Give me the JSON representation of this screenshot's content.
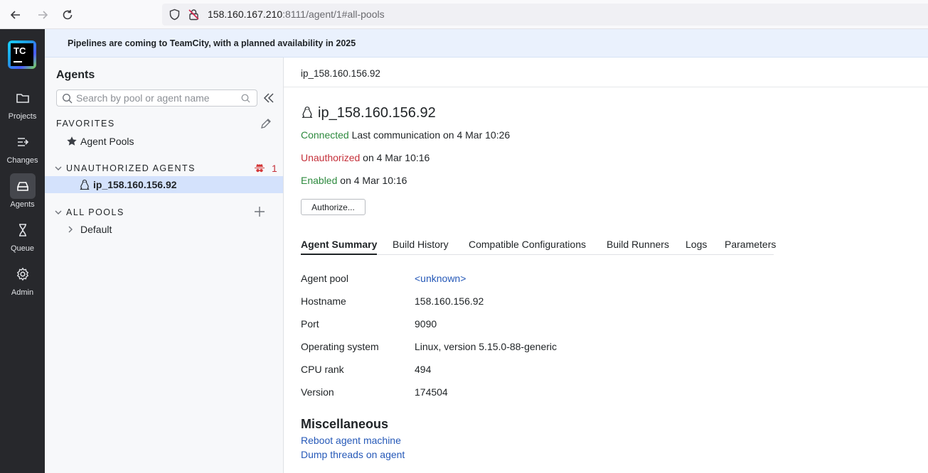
{
  "browser": {
    "url_host": "158.160.167.210",
    "url_rest": ":8111/agent/1#all-pools"
  },
  "rail": {
    "logo_text": "TC",
    "items": [
      {
        "label": "Projects",
        "icon": "folder-icon"
      },
      {
        "label": "Changes",
        "icon": "changes-icon"
      },
      {
        "label": "Agents",
        "icon": "agents-icon"
      },
      {
        "label": "Queue",
        "icon": "hourglass-icon"
      },
      {
        "label": "Admin",
        "icon": "gear-icon"
      }
    ],
    "active": "Agents"
  },
  "banner": {
    "text": "Pipelines are coming to TeamCity, with a planned availability in 2025"
  },
  "sidebar": {
    "title": "Agents",
    "search_placeholder": "Search by pool or agent name",
    "favorites_label": "FAVORITES",
    "agent_pools_label": "Agent Pools",
    "unauthorized_label": "UNAUTHORIZED AGENTS",
    "unauthorized_count": "1",
    "selected_agent": "ip_158.160.156.92",
    "all_pools_label": "ALL POOLS",
    "default_pool": "Default"
  },
  "main": {
    "breadcrumb": "ip_158.160.156.92",
    "agent_name": "ip_158.160.156.92",
    "connected_label": "Connected",
    "connected_detail": "Last communication on 4 Mar 10:26",
    "unauthorized_label": "Unauthorized",
    "unauthorized_detail": "on 4 Mar 10:16",
    "enabled_label": "Enabled",
    "enabled_detail": "on 4 Mar 10:16",
    "authorize_button": "Authorize...",
    "tabs": [
      "Agent Summary",
      "Build History",
      "Compatible Configurations",
      "Build Runners",
      "Logs",
      "Parameters"
    ],
    "active_tab": "Agent Summary",
    "properties": [
      {
        "label": "Agent pool",
        "value": "<unknown>"
      },
      {
        "label": "Hostname",
        "value": "158.160.156.92"
      },
      {
        "label": "Port",
        "value": "9090"
      },
      {
        "label": "Operating system",
        "value": "Linux, version 5.15.0-88-generic"
      },
      {
        "label": "CPU rank",
        "value": "494"
      },
      {
        "label": "Version",
        "value": "174504"
      }
    ],
    "misc_title": "Miscellaneous",
    "misc_links": [
      "Reboot agent machine",
      "Dump threads on agent"
    ]
  },
  "colors": {
    "rail_bg": "#27282c",
    "banner_bg": "#eaf1fd",
    "selected_row": "#d4e2fc",
    "status_green": "#2d8a3e",
    "status_red": "#c5303a",
    "link": "#2659b8"
  }
}
